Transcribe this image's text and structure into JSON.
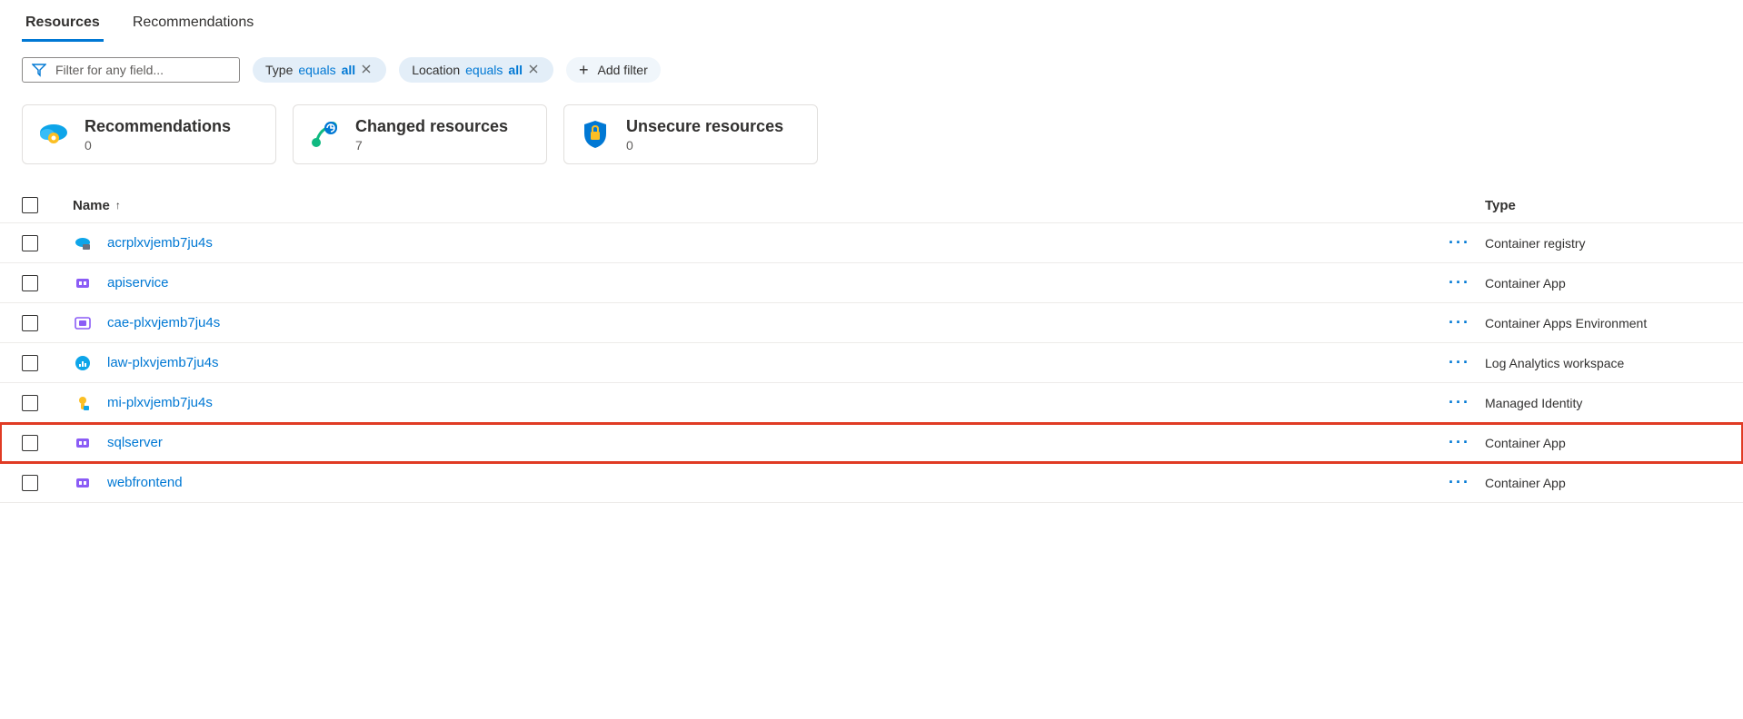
{
  "tabs": [
    {
      "label": "Resources",
      "active": true
    },
    {
      "label": "Recommendations",
      "active": false
    }
  ],
  "filterInput": {
    "placeholder": "Filter for any field..."
  },
  "filterPills": [
    {
      "label": "Type",
      "op": "equals",
      "value": "all"
    },
    {
      "label": "Location",
      "op": "equals",
      "value": "all"
    }
  ],
  "addFilterLabel": "Add filter",
  "cards": [
    {
      "title": "Recommendations",
      "count": "0",
      "icon": "cloud-gear"
    },
    {
      "title": "Changed resources",
      "count": "7",
      "icon": "changes"
    },
    {
      "title": "Unsecure resources",
      "count": "0",
      "icon": "shield-lock"
    }
  ],
  "columns": {
    "name": "Name",
    "type": "Type"
  },
  "rows": [
    {
      "name": "acrplxvjemb7ju4s",
      "type": "Container registry",
      "icon": "acr",
      "highlighted": false
    },
    {
      "name": "apiservice",
      "type": "Container App",
      "icon": "capp",
      "highlighted": false
    },
    {
      "name": "cae-plxvjemb7ju4s",
      "type": "Container Apps Environment",
      "icon": "cae",
      "highlighted": false
    },
    {
      "name": "law-plxvjemb7ju4s",
      "type": "Log Analytics workspace",
      "icon": "law",
      "highlighted": false
    },
    {
      "name": "mi-plxvjemb7ju4s",
      "type": "Managed Identity",
      "icon": "mi",
      "highlighted": false
    },
    {
      "name": "sqlserver",
      "type": "Container App",
      "icon": "capp",
      "highlighted": true
    },
    {
      "name": "webfrontend",
      "type": "Container App",
      "icon": "capp",
      "highlighted": false
    }
  ]
}
